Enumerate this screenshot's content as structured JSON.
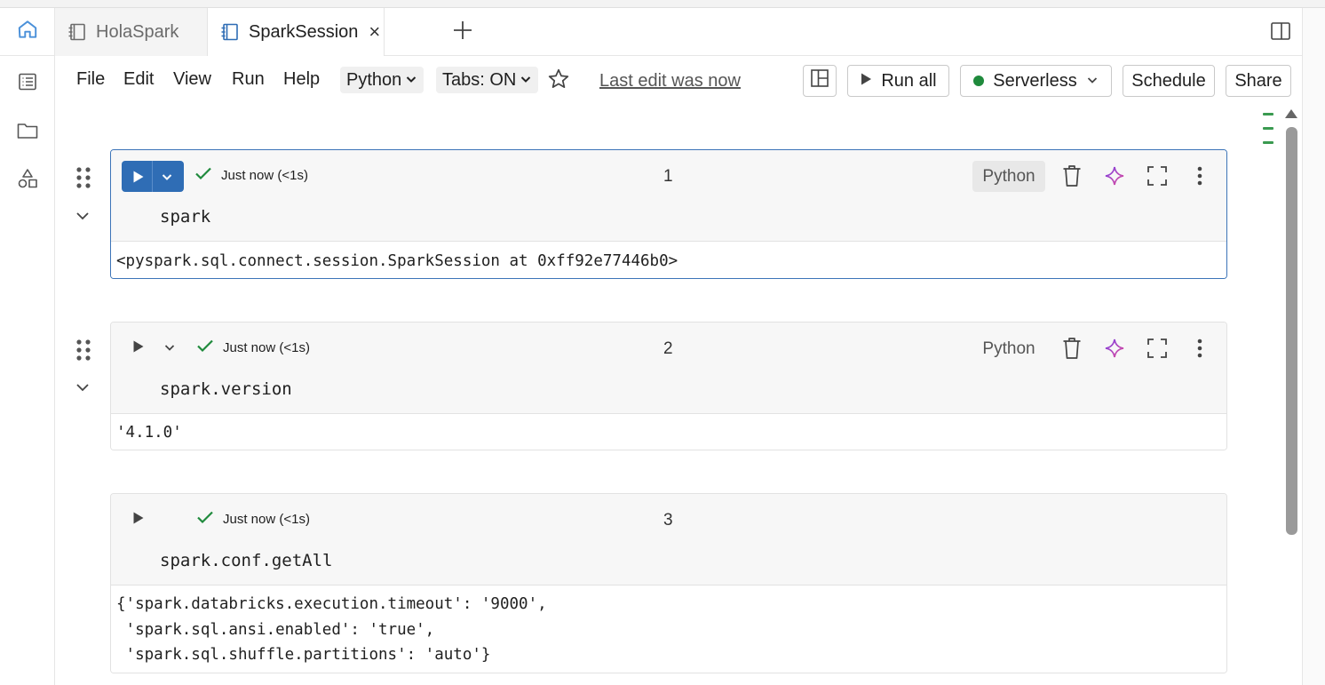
{
  "tabs": [
    {
      "label": "HolaSpark",
      "active": false
    },
    {
      "label": "SparkSession",
      "active": true,
      "close": "×"
    }
  ],
  "menu": {
    "items": [
      "File",
      "Edit",
      "View",
      "Run",
      "Help"
    ],
    "language": "Python",
    "tabs_mode": "Tabs: ON",
    "last_edit": "Last edit was now"
  },
  "toolbar": {
    "run_all": "Run all",
    "compute": "Serverless",
    "compute_status_color": "#1f8a3c",
    "schedule": "Schedule",
    "share": "Share"
  },
  "cells": [
    {
      "number": "1",
      "status": "Just now (<1s)",
      "language": "Python",
      "code": "spark",
      "output": "<pyspark.sql.connect.session.SparkSession at 0xff92e77446b0>"
    },
    {
      "number": "2",
      "status": "Just now (<1s)",
      "language": "Python",
      "code": "spark.version",
      "output": "'4.1.0'"
    },
    {
      "number": "3",
      "status": "Just now (<1s)",
      "code": "spark.conf.getAll",
      "output": "{'spark.databricks.execution.timeout': '9000',\n 'spark.sql.ansi.enabled': 'true',\n 'spark.sql.shuffle.partitions': 'auto'}"
    }
  ],
  "colors": {
    "accent": "#2f6db5",
    "success": "#1f8a3c",
    "assistant_gradient_start": "#7b3fe4",
    "assistant_gradient_end": "#e04e9b"
  }
}
